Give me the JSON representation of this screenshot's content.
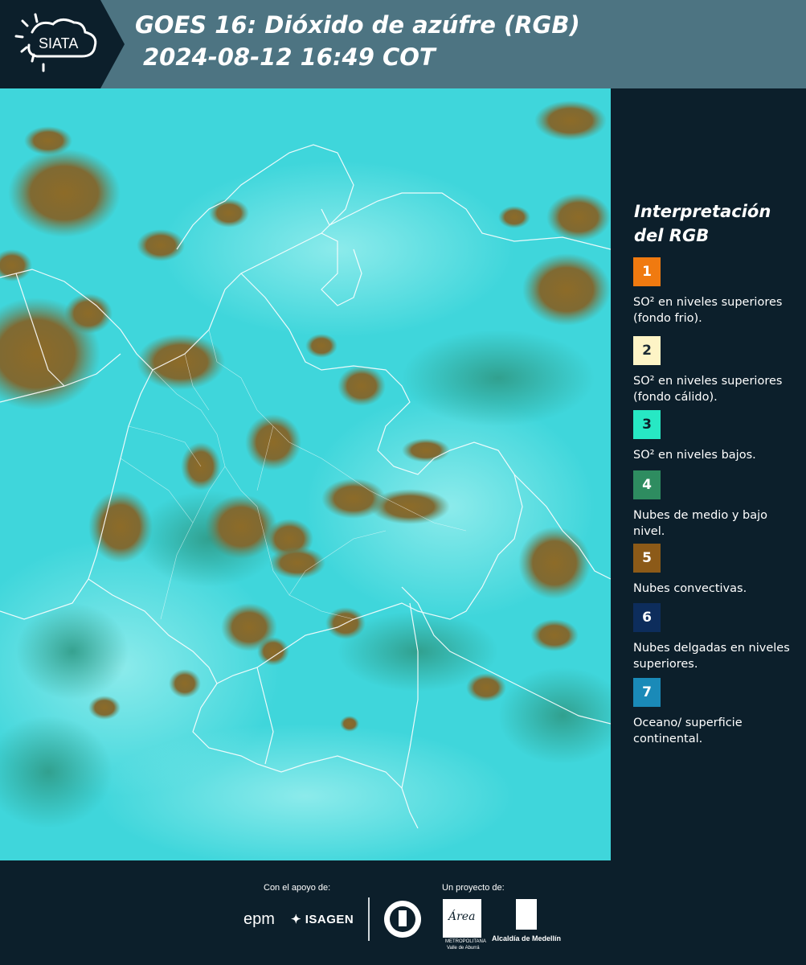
{
  "header": {
    "logo_text": "SIATA",
    "title_line1": "GOES 16: Dióxido de azúfre (RGB)",
    "title_line2": "2024-08-12 16:49 COT",
    "background_color": "#4d7482"
  },
  "legend": {
    "title": "Interpretación del RGB",
    "items": [
      {
        "number": "1",
        "color": "#f07a10",
        "text_color": "#ffffff",
        "text": "SO² en niveles superiores (fondo frio)."
      },
      {
        "number": "2",
        "color": "#fdf4c6",
        "text_color": "#1b2a33",
        "text": "SO² en niveles superiores (fondo cálido)."
      },
      {
        "number": "3",
        "color": "#27e8c4",
        "text_color": "#0c1f2b",
        "text": "SO² en niveles bajos."
      },
      {
        "number": "4",
        "color": "#2e8c60",
        "text_color": "#ffffff",
        "text": "Nubes de medio y bajo nivel."
      },
      {
        "number": "5",
        "color": "#8c5a18",
        "text_color": "#ffffff",
        "text": "Nubes convectivas."
      },
      {
        "number": "6",
        "color": "#0d2d5c",
        "text_color": "#ffffff",
        "text": "Nubes delgadas en niveles superiores."
      },
      {
        "number": "7",
        "color": "#1a8ab8",
        "text_color": "#ffffff",
        "text": "Oceano/ superficie continental."
      }
    ]
  },
  "footer": {
    "support_label": "Con el apoyo de:",
    "project_label": "Un proyecto de:",
    "sponsor_epm": "epm",
    "sponsor_isagen": "ISAGEN",
    "area_word": "Área",
    "area_sub1": "METROPOLITANA",
    "area_sub2": "Valle de Aburrá",
    "alcaldia": "Alcaldía de Medellín"
  },
  "map": {
    "ocean_color": "#3fd6db",
    "cloud_color": "#8a6a2c",
    "border_color": "#ffffff"
  }
}
